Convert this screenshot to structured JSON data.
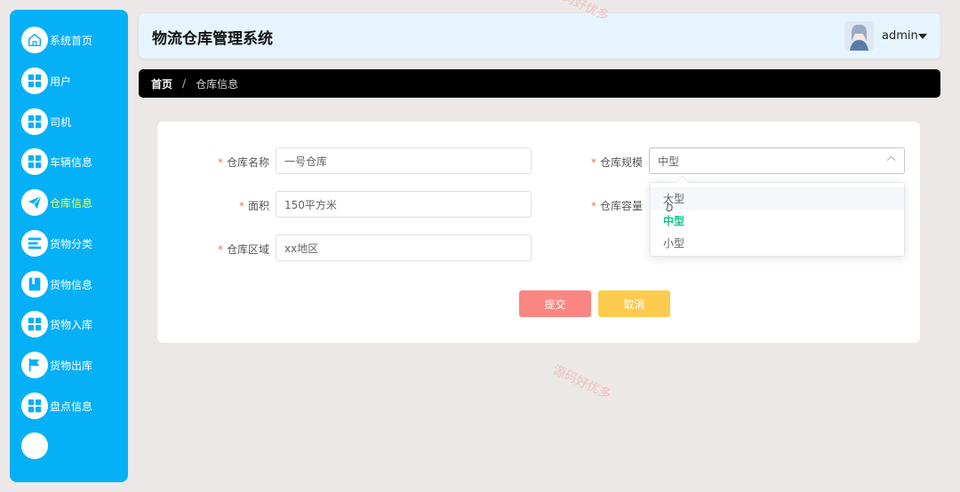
{
  "app": {
    "title": "物流仓库管理系统",
    "username": "admin"
  },
  "sidebar": {
    "items": [
      {
        "label": "系统首页",
        "icon": "home-icon",
        "active": false
      },
      {
        "label": "用户",
        "icon": "grid-icon",
        "active": false
      },
      {
        "label": "司机",
        "icon": "grid-icon",
        "active": false
      },
      {
        "label": "车辆信息",
        "icon": "grid-icon",
        "active": false
      },
      {
        "label": "仓库信息",
        "icon": "paper-plane-icon",
        "active": true
      },
      {
        "label": "货物分类",
        "icon": "list-icon",
        "active": false
      },
      {
        "label": "货物信息",
        "icon": "book-icon",
        "active": false
      },
      {
        "label": "货物入库",
        "icon": "grid-icon",
        "active": false
      },
      {
        "label": "货物出库",
        "icon": "flag-icon",
        "active": false
      },
      {
        "label": "盘点信息",
        "icon": "grid-icon",
        "active": false
      }
    ]
  },
  "breadcrumb": {
    "home": "首页",
    "separator": "/",
    "current": "仓库信息"
  },
  "form": {
    "name_label": "仓库名称",
    "name_value": "一号仓库",
    "area_label": "面积",
    "area_value": "150平方米",
    "region_label": "仓库区域",
    "region_value": "xx地区",
    "scale_label": "仓库规模",
    "scale_value": "中型",
    "capacity_label": "仓库容量",
    "required_mark": "*",
    "submit_label": "提交",
    "cancel_label": "取消"
  },
  "dropdown": {
    "options": [
      {
        "label": "大型",
        "state": "hover"
      },
      {
        "label": "中型",
        "state": "selected"
      },
      {
        "label": "小型",
        "state": "normal"
      }
    ]
  },
  "watermark": {
    "text": "源码好优多"
  },
  "colors": {
    "sidebar_bg": "#06b0f6",
    "sidebar_active_text": "#faff3e",
    "header_bg": "#e6f4fd",
    "breadcrumb_bg": "#000000",
    "submit_bg": "#f98680",
    "cancel_bg": "#fdcb4e",
    "selected_option": "#14c28c",
    "required": "#f56c6c"
  }
}
